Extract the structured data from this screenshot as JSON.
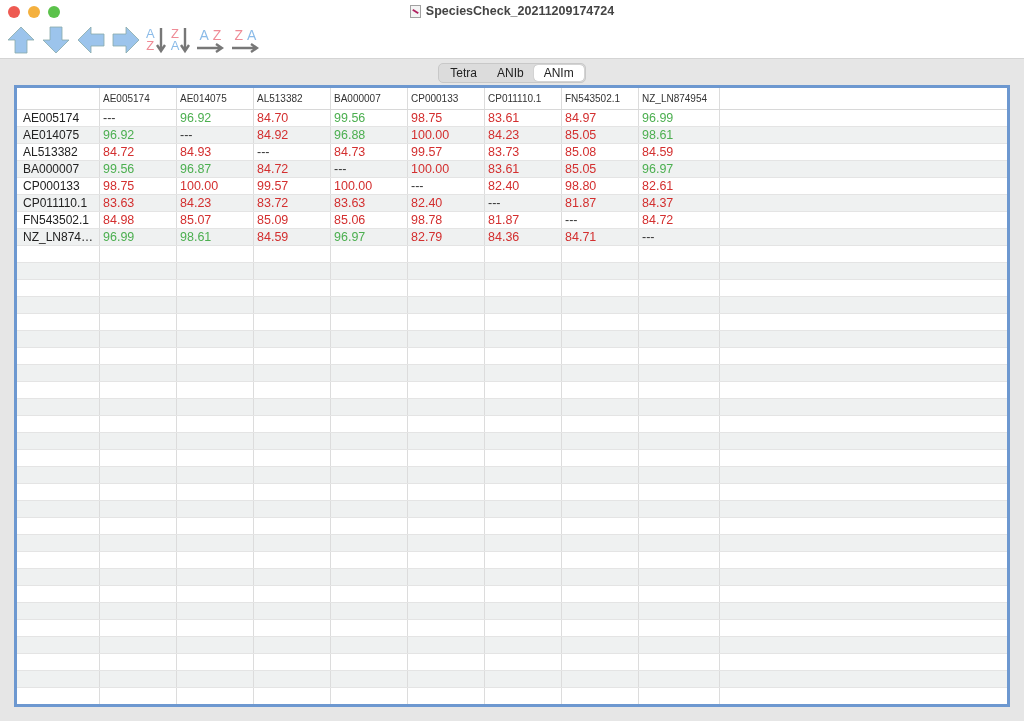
{
  "window": {
    "title": "SpeciesCheck_20211209174724"
  },
  "toolbar": [
    {
      "kind": "up"
    },
    {
      "kind": "down"
    },
    {
      "kind": "left"
    },
    {
      "kind": "right"
    },
    {
      "kind": "sort-vertical",
      "first": "A",
      "second": "Z"
    },
    {
      "kind": "sort-vertical",
      "first": "Z",
      "second": "A"
    },
    {
      "kind": "sort-horizontal",
      "first": "A",
      "second": "Z"
    },
    {
      "kind": "sort-horizontal",
      "first": "Z",
      "second": "A"
    }
  ],
  "tabs": [
    {
      "label": "Tetra",
      "selected": false
    },
    {
      "label": "ANIb",
      "selected": false
    },
    {
      "label": "ANIm",
      "selected": true
    }
  ],
  "table": {
    "columns": [
      "AE005174",
      "AE014075",
      "AL513382",
      "BA000007",
      "CP000133",
      "CP011110.1",
      "FN543502.1",
      "NZ_LN874954"
    ],
    "rows": [
      {
        "name": "AE005174",
        "cells": [
          {
            "text": "---"
          },
          {
            "text": "96.92",
            "color": "#4caf50"
          },
          {
            "text": "84.70",
            "color": "#d32f2f"
          },
          {
            "text": "99.56",
            "color": "#4caf50"
          },
          {
            "text": "98.75",
            "color": "#d32f2f"
          },
          {
            "text": "83.61",
            "color": "#d32f2f"
          },
          {
            "text": "84.97",
            "color": "#d32f2f"
          },
          {
            "text": "96.99",
            "color": "#4caf50"
          }
        ]
      },
      {
        "name": "AE014075",
        "cells": [
          {
            "text": "96.92",
            "color": "#4caf50"
          },
          {
            "text": "---"
          },
          {
            "text": "84.92",
            "color": "#d32f2f"
          },
          {
            "text": "96.88",
            "color": "#4caf50"
          },
          {
            "text": "100.00",
            "color": "#d32f2f"
          },
          {
            "text": "84.23",
            "color": "#d32f2f"
          },
          {
            "text": "85.05",
            "color": "#d32f2f"
          },
          {
            "text": "98.61",
            "color": "#4caf50"
          }
        ]
      },
      {
        "name": "AL513382",
        "cells": [
          {
            "text": "84.72",
            "color": "#d32f2f"
          },
          {
            "text": "84.93",
            "color": "#d32f2f"
          },
          {
            "text": "---"
          },
          {
            "text": "84.73",
            "color": "#d32f2f"
          },
          {
            "text": "99.57",
            "color": "#d32f2f"
          },
          {
            "text": "83.73",
            "color": "#d32f2f"
          },
          {
            "text": "85.08",
            "color": "#d32f2f"
          },
          {
            "text": "84.59",
            "color": "#d32f2f"
          }
        ]
      },
      {
        "name": "BA000007",
        "cells": [
          {
            "text": "99.56",
            "color": "#4caf50"
          },
          {
            "text": "96.87",
            "color": "#4caf50"
          },
          {
            "text": "84.72",
            "color": "#d32f2f"
          },
          {
            "text": "---"
          },
          {
            "text": "100.00",
            "color": "#d32f2f"
          },
          {
            "text": "83.61",
            "color": "#d32f2f"
          },
          {
            "text": "85.05",
            "color": "#d32f2f"
          },
          {
            "text": "96.97",
            "color": "#4caf50"
          }
        ]
      },
      {
        "name": "CP000133",
        "cells": [
          {
            "text": "98.75",
            "color": "#d32f2f"
          },
          {
            "text": "100.00",
            "color": "#d32f2f"
          },
          {
            "text": "99.57",
            "color": "#d32f2f"
          },
          {
            "text": "100.00",
            "color": "#d32f2f"
          },
          {
            "text": "---"
          },
          {
            "text": "82.40",
            "color": "#d32f2f"
          },
          {
            "text": "98.80",
            "color": "#d32f2f"
          },
          {
            "text": "82.61",
            "color": "#d32f2f"
          }
        ]
      },
      {
        "name": "CP011110.1",
        "cells": [
          {
            "text": "83.63",
            "color": "#d32f2f"
          },
          {
            "text": "84.23",
            "color": "#d32f2f"
          },
          {
            "text": "83.72",
            "color": "#d32f2f"
          },
          {
            "text": "83.63",
            "color": "#d32f2f"
          },
          {
            "text": "82.40",
            "color": "#d32f2f"
          },
          {
            "text": "---"
          },
          {
            "text": "81.87",
            "color": "#d32f2f"
          },
          {
            "text": "84.37",
            "color": "#d32f2f"
          }
        ]
      },
      {
        "name": "FN543502.1",
        "cells": [
          {
            "text": "84.98",
            "color": "#d32f2f"
          },
          {
            "text": "85.07",
            "color": "#d32f2f"
          },
          {
            "text": "85.09",
            "color": "#d32f2f"
          },
          {
            "text": "85.06",
            "color": "#d32f2f"
          },
          {
            "text": "98.78",
            "color": "#d32f2f"
          },
          {
            "text": "81.87",
            "color": "#d32f2f"
          },
          {
            "text": "---"
          },
          {
            "text": "84.72",
            "color": "#d32f2f"
          }
        ]
      },
      {
        "name": "NZ_LN874…",
        "cells": [
          {
            "text": "96.99",
            "color": "#4caf50"
          },
          {
            "text": "98.61",
            "color": "#4caf50"
          },
          {
            "text": "84.59",
            "color": "#d32f2f"
          },
          {
            "text": "96.97",
            "color": "#4caf50"
          },
          {
            "text": "82.79",
            "color": "#d32f2f"
          },
          {
            "text": "84.36",
            "color": "#d32f2f"
          },
          {
            "text": "84.71",
            "color": "#d32f2f"
          },
          {
            "text": "---"
          }
        ]
      }
    ]
  }
}
